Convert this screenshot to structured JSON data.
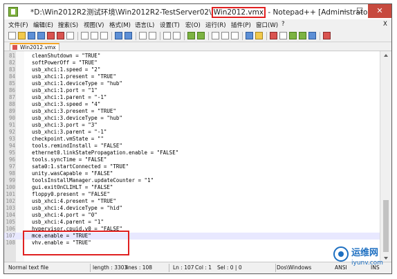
{
  "window": {
    "title_prefix": "*D:\\Win2012R2测试环境\\Win2012R2-TestServer02\\",
    "title_file": "Win2012.vmx",
    "title_suffix": " - Notepad++ [Administrator]",
    "min_glyph": "—",
    "max_glyph": "☐",
    "close_glyph": "✕"
  },
  "menu": [
    "文件(F)",
    "编辑(E)",
    "搜索(S)",
    "视图(V)",
    "格式(M)",
    "语言(L)",
    "设置(T)",
    "宏(O)",
    "运行(R)",
    "插件(P)",
    "窗口(W)",
    "?"
  ],
  "menu_close": "X",
  "tab": {
    "label": "Win2012.vmx"
  },
  "lines": [
    {
      "n": "81",
      "text": "cleanShutdown = \"TRUE\""
    },
    {
      "n": "82",
      "text": "softPowerOff = \"TRUE\""
    },
    {
      "n": "83",
      "text": "usb_xhci:1.speed = \"2\""
    },
    {
      "n": "84",
      "text": "usb_xhci:1.present = \"TRUE\""
    },
    {
      "n": "85",
      "text": "usb_xhci:1.deviceType = \"hub\""
    },
    {
      "n": "86",
      "text": "usb_xhci:1.port = \"1\""
    },
    {
      "n": "87",
      "text": "usb_xhci:1.parent = \"-1\""
    },
    {
      "n": "88",
      "text": "usb_xhci:3.speed = \"4\""
    },
    {
      "n": "89",
      "text": "usb_xhci:3.present = \"TRUE\""
    },
    {
      "n": "90",
      "text": "usb_xhci:3.deviceType = \"hub\""
    },
    {
      "n": "91",
      "text": "usb_xhci:3.port = \"3\""
    },
    {
      "n": "92",
      "text": "usb_xhci:3.parent = \"-1\""
    },
    {
      "n": "93",
      "text": "checkpoint.vmState = \"\""
    },
    {
      "n": "94",
      "text": "tools.remindInstall = \"FALSE\""
    },
    {
      "n": "95",
      "text": "ethernet0.linkStatePropagation.enable = \"FALSE\""
    },
    {
      "n": "96",
      "text": "tools.syncTime = \"FALSE\""
    },
    {
      "n": "97",
      "text": "sata0:1.startConnected = \"TRUE\""
    },
    {
      "n": "98",
      "text": "unity.wasCapable = \"FALSE\""
    },
    {
      "n": "99",
      "text": "toolsInstallManager.updateCounter = \"1\""
    },
    {
      "n": "100",
      "text": "gui.exitOnCLIHLT = \"FALSE\""
    },
    {
      "n": "101",
      "text": "floppy0.present = \"FALSE\""
    },
    {
      "n": "102",
      "text": "usb_xhci:4.present = \"TRUE\""
    },
    {
      "n": "103",
      "text": "usb_xhci:4.deviceType = \"hid\""
    },
    {
      "n": "104",
      "text": "usb_xhci:4.port = \"0\""
    },
    {
      "n": "105",
      "text": "usb_xhci:4.parent = \"1\""
    },
    {
      "n": "106",
      "text": "hypervisor.cpuid.v0 = \"FALSE\""
    },
    {
      "n": "107",
      "text": "mce.enable = \"TRUE\""
    },
    {
      "n": "108",
      "text": "vhv.enable = \"TRUE\""
    }
  ],
  "status": {
    "type": "Normal text file",
    "length": "length : 3303",
    "lines": "lines : 108",
    "ln": "Ln : 107",
    "col": "Col : 1",
    "sel": "Sel : 0 | 0",
    "eol": "Dos\\Windows",
    "enc": "ANSI",
    "mode": "INS"
  },
  "watermark": {
    "main": "运维网",
    "sub": "iyunv.com"
  },
  "colors": {
    "highlight": "#e02020",
    "current_line": "#e8e8ff",
    "close_button": "#c74a3f"
  }
}
